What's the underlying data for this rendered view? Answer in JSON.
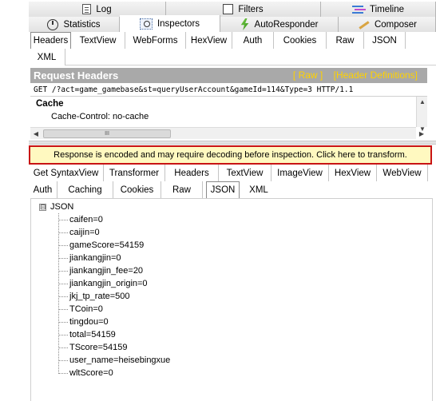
{
  "top_tabs_row1": [
    {
      "label": "Log",
      "icon": "log-icon"
    },
    {
      "label": "Filters",
      "icon": "filter-icon"
    },
    {
      "label": "Timeline",
      "icon": "timeline-icon"
    }
  ],
  "top_tabs_row2": [
    {
      "label": "Statistics",
      "icon": "statistics-icon"
    },
    {
      "label": "Inspectors",
      "icon": "inspectors-icon",
      "active": true
    },
    {
      "label": "AutoResponder",
      "icon": "lightning-icon"
    },
    {
      "label": "Composer",
      "icon": "pencil-icon"
    }
  ],
  "request_tabs": [
    "Headers",
    "TextView",
    "WebForms",
    "HexView",
    "Auth",
    "Cookies",
    "Raw",
    "JSON",
    "XML"
  ],
  "request_active_tab": "Headers",
  "request_headers": {
    "title": "Request Headers",
    "raw_link": "[ Raw ]",
    "definitions_link": "[Header Definitions]",
    "request_line": "GET /?act=game_gamebase&st=queryUserAccount&gameId=114&Type=3 HTTP/1.1",
    "section": "Cache",
    "header_line": "Cache-Control: no-cache",
    "scroll_thumb": "III"
  },
  "transform_banner": "Response is encoded and may require decoding before inspection. Click here to transform.",
  "response_tabs_row1": [
    "Get SyntaxView",
    "Transformer",
    "Headers",
    "TextView",
    "ImageView",
    "HexView",
    "WebView"
  ],
  "response_tabs_row2": [
    "Auth",
    "Caching",
    "Cookies",
    "Raw",
    "JSON",
    "XML"
  ],
  "response_active_tab": "JSON",
  "json_tree": {
    "root": "JSON",
    "expander": "⊟",
    "nodes": [
      "caifen=0",
      "caijin=0",
      "gameScore=54159",
      "jiankangjin=0",
      "jiankangjin_fee=20",
      "jiankangjin_origin=0",
      "jkj_tp_rate=500",
      "TCoin=0",
      "tingdou=0",
      "total=54159",
      "TScore=54159",
      "user_name=heisebingxue",
      "wltScore=0"
    ]
  },
  "colors": {
    "header_bar": "#a9a9a9",
    "header_links": "#ffd200",
    "banner_border": "#c81414",
    "banner_bg": "#fff9c0"
  }
}
